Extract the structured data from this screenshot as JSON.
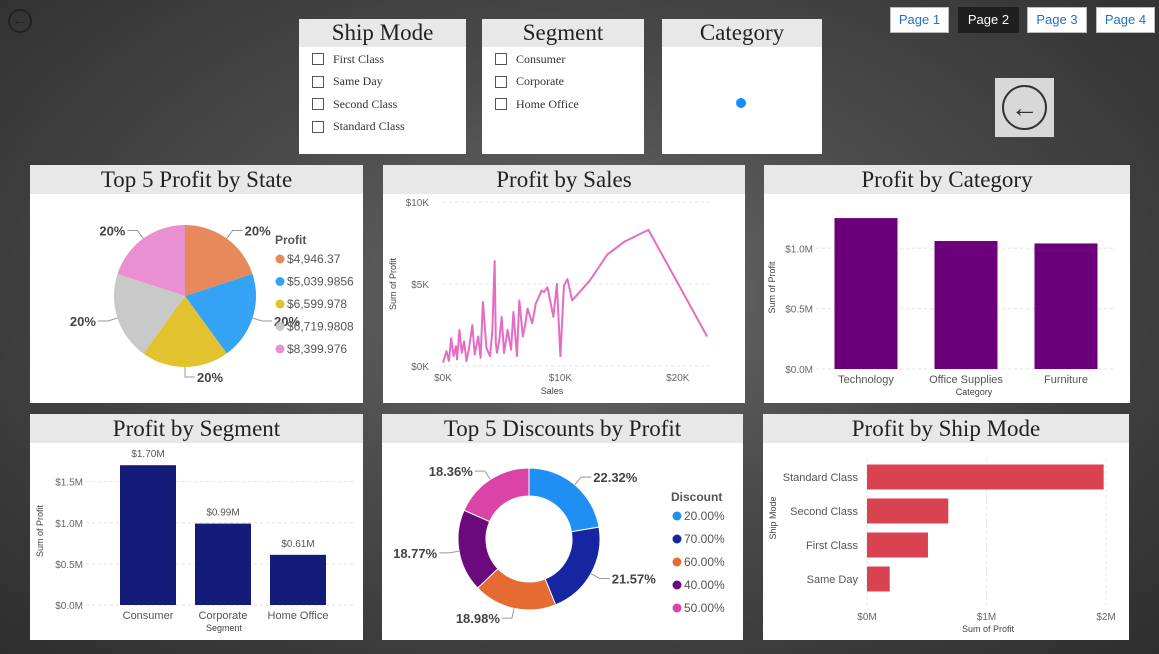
{
  "slicers": {
    "ship_mode": {
      "title": "Ship Mode",
      "items": [
        "First Class",
        "Same Day",
        "Second Class",
        "Standard Class"
      ]
    },
    "segment": {
      "title": "Segment",
      "items": [
        "Consumer",
        "Corporate",
        "Home Office"
      ]
    },
    "category": {
      "title": "Category"
    }
  },
  "pages": [
    "Page 1",
    "Page 2",
    "Page 3",
    "Page 4"
  ],
  "active_page": "Page 2",
  "colors": {
    "pie": [
      "#e8895c",
      "#34a2f5",
      "#e3c22f",
      "#c9c9c9",
      "#ea8fcf"
    ],
    "line": "#e46cc4",
    "category_bar": "#6c007a",
    "segment_bar": "#131c79",
    "shipmode_bar": "#d9424f",
    "donut": [
      "#1f8ff3",
      "#1626a0",
      "#e66b32",
      "#6a0a7d",
      "#db44a6"
    ]
  },
  "charts": {
    "profit_by_state": {
      "title": "Top 5 Profit by State"
    },
    "profit_by_sales": {
      "title": "Profit by Sales"
    },
    "profit_by_category": {
      "title": "Profit by Category"
    },
    "profit_by_segment": {
      "title": "Profit by Segment"
    },
    "discounts_by_profit": {
      "title": "Top 5 Discounts by Profit"
    },
    "profit_by_ship_mode": {
      "title": "Profit by Ship Mode"
    }
  },
  "chart_data": [
    {
      "id": "profit_by_state",
      "type": "pie",
      "title": "Top 5 Profit by State",
      "legend_title": "Profit",
      "legend_placement": "right",
      "labels": [
        "$4,946.37",
        "$5,039.9856",
        "$6,599.978",
        "$6,719.9808",
        "$8,399.976"
      ],
      "values": [
        20,
        20,
        20,
        20,
        20
      ],
      "data_labels": [
        "20%",
        "20%",
        "20%",
        "20%",
        "20%"
      ]
    },
    {
      "id": "profit_by_sales",
      "type": "line",
      "title": "Profit by Sales",
      "xlabel": "Sales",
      "ylabel": "Sum of Profit",
      "x_ticks": [
        "$0K",
        "$10K",
        "$20K"
      ],
      "y_ticks": [
        "$0K",
        "$5K",
        "$10K"
      ],
      "xlim": [
        0,
        23000
      ],
      "ylim": [
        0,
        10000
      ],
      "x": [
        0,
        300,
        500,
        700,
        900,
        1100,
        1200,
        1400,
        1600,
        1800,
        2000,
        2200,
        2500,
        2700,
        3000,
        3200,
        3400,
        3700,
        4000,
        4200,
        4400,
        4500,
        4600,
        4800,
        5000,
        5200,
        5500,
        5800,
        6000,
        6300,
        6500,
        6800,
        7000,
        7200,
        7600,
        7900,
        8400,
        8600,
        8900,
        9400,
        9700,
        10000,
        10300,
        10600,
        11000,
        12500,
        14000,
        15500,
        17500,
        22500
      ],
      "y": [
        200,
        900,
        300,
        1700,
        600,
        1200,
        400,
        2200,
        800,
        1500,
        300,
        1000,
        2500,
        700,
        1800,
        500,
        3900,
        1100,
        600,
        2100,
        6400,
        1400,
        800,
        1600,
        3000,
        800,
        2200,
        1000,
        3300,
        600,
        4000,
        1800,
        2500,
        3500,
        2600,
        3800,
        4600,
        4500,
        4800,
        3000,
        5000,
        600,
        4900,
        5300,
        4000,
        5200,
        6800,
        7600,
        8300,
        1800
      ],
      "grid": true
    },
    {
      "id": "profit_by_category",
      "type": "bar",
      "title": "Profit by Category",
      "categories": [
        "Technology",
        "Office Supplies",
        "Furniture"
      ],
      "values": [
        1.25,
        1.06,
        1.04
      ],
      "y_ticks": [
        "$0.0M",
        "$0.5M",
        "$1.0M"
      ],
      "ylim": [
        0,
        1.35
      ],
      "xlabel": "Category",
      "ylabel": "Sum of Profit",
      "grid": true
    },
    {
      "id": "profit_by_segment",
      "type": "bar",
      "title": "Profit by Segment",
      "categories": [
        "Consumer",
        "Corporate",
        "Home Office"
      ],
      "values": [
        1.7,
        0.99,
        0.61
      ],
      "data_labels": [
        "$1.70M",
        "$0.99M",
        "$0.61M"
      ],
      "y_ticks": [
        "$0.0M",
        "$0.5M",
        "$1.0M",
        "$1.5M"
      ],
      "ylim": [
        0,
        1.8
      ],
      "xlabel": "Segment",
      "ylabel": "Sum of Profit",
      "grid": true
    },
    {
      "id": "discounts_by_profit",
      "type": "pie",
      "subtype": "donut",
      "title": "Top 5 Discounts by Profit",
      "legend_title": "Discount",
      "legend_placement": "right",
      "labels": [
        "20.00%",
        "70.00%",
        "60.00%",
        "40.00%",
        "50.00%"
      ],
      "values": [
        22.32,
        21.57,
        18.98,
        18.77,
        18.36
      ],
      "data_labels": [
        "22.32%",
        "21.57%",
        "18.98%",
        "18.77%",
        "18.36%"
      ]
    },
    {
      "id": "profit_by_ship_mode",
      "type": "bar",
      "orientation": "horizontal",
      "title": "Profit by Ship Mode",
      "categories": [
        "Standard Class",
        "Second Class",
        "First Class",
        "Same Day"
      ],
      "values": [
        1.98,
        0.68,
        0.51,
        0.19
      ],
      "x_ticks": [
        "$0M",
        "$1M",
        "$2M"
      ],
      "xlim": [
        0,
        2.1
      ],
      "xlabel": "Sum of Profit",
      "ylabel": "Ship Mode",
      "grid": true
    }
  ]
}
